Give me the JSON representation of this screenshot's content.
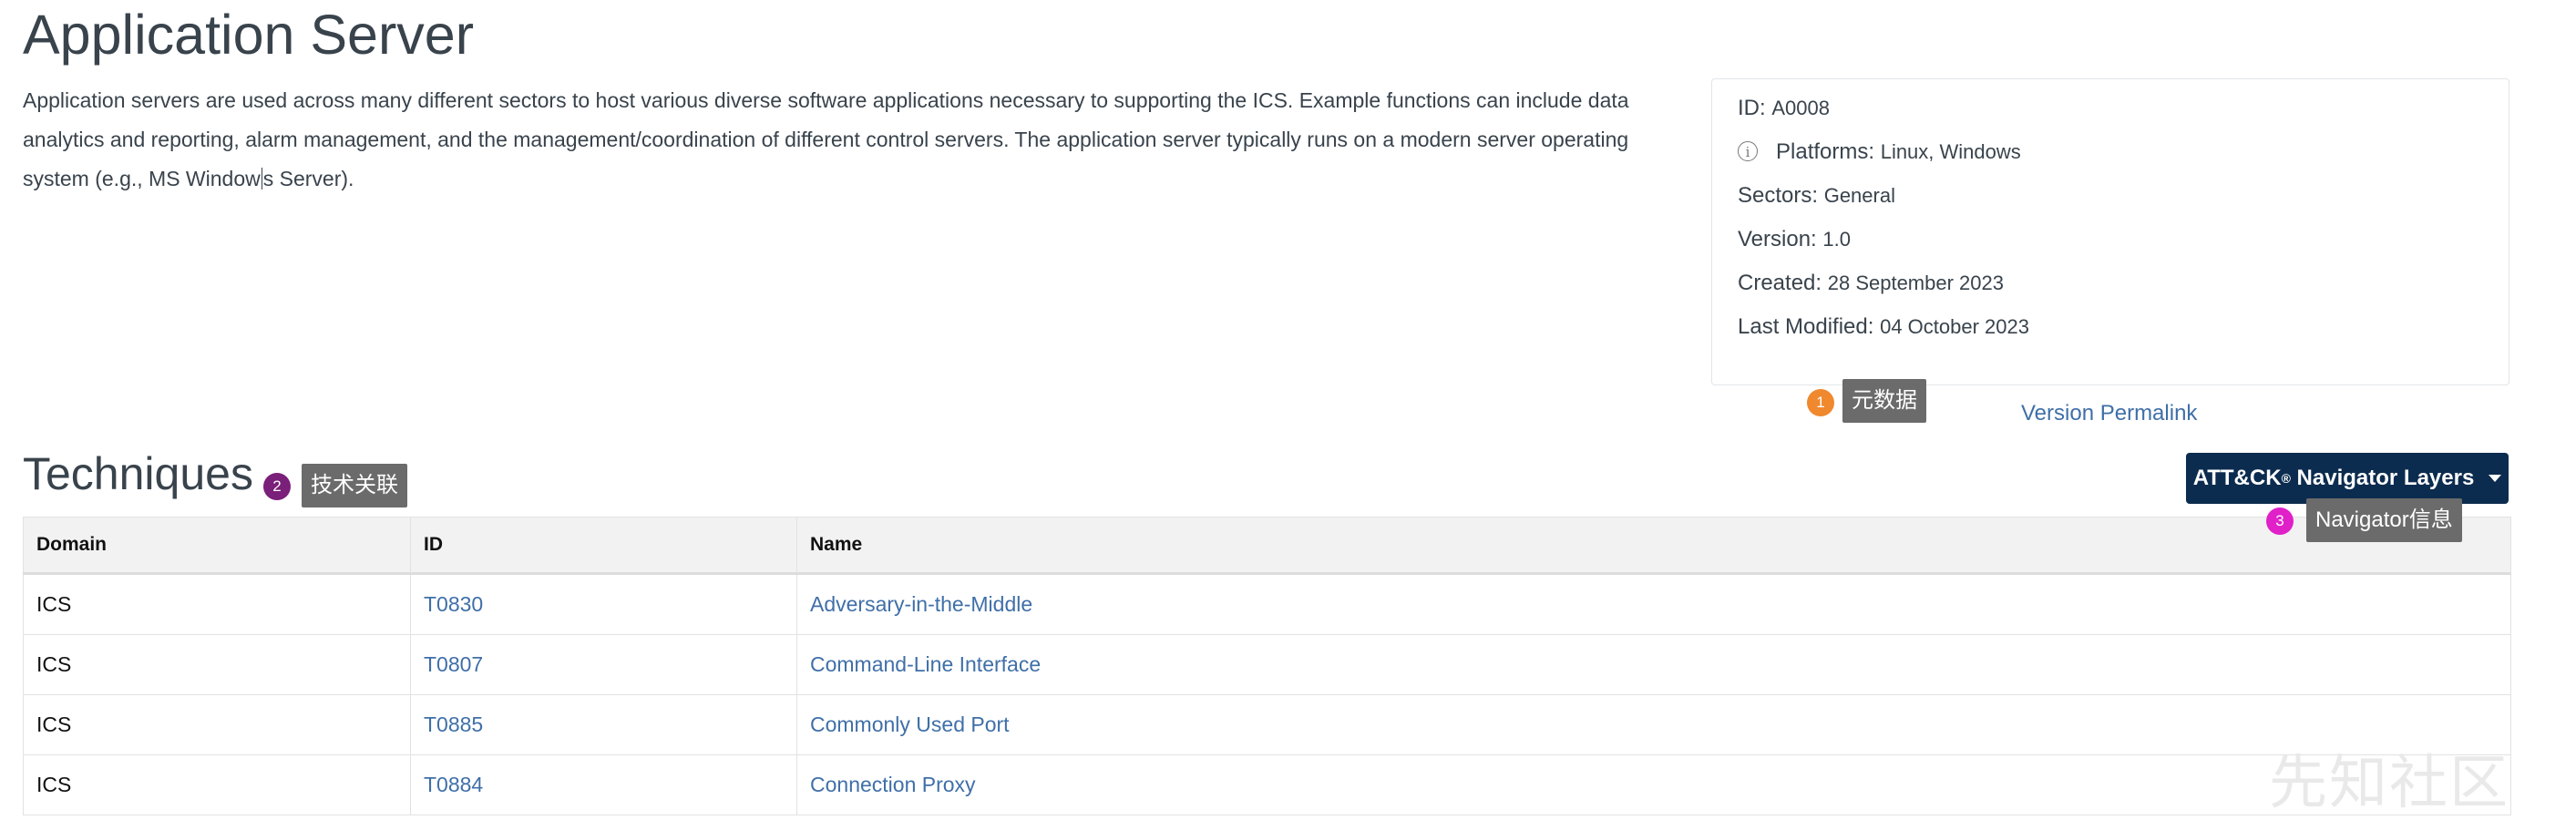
{
  "page": {
    "title": "Application Server",
    "description_part1": "Application servers are used across many different sectors to host various diverse software applications necessary to supporting the ICS. Example functions can include data analytics and reporting, alarm management, and the management/coordination of different control servers. The application server typically runs on a modern server operating system (e.g., MS Window",
    "description_part2": "s Server)."
  },
  "metadata": {
    "id_label": "ID:",
    "id_value": "A0008",
    "platforms_label": "Platforms:",
    "platforms_value": "Linux, Windows",
    "sectors_label": "Sectors:",
    "sectors_value": "General",
    "version_label": "Version:",
    "version_value": "1.0",
    "created_label": "Created:",
    "created_value": "28 September 2023",
    "modified_label": "Last Modified:",
    "modified_value": "04 October 2023",
    "info_icon": "info-circle-icon"
  },
  "permalink": "Version Permalink",
  "annotations": [
    {
      "num": "1",
      "text": "元数据",
      "color": "#f0882e"
    },
    {
      "num": "2",
      "text": "技术关联",
      "color": "#7a1f7a"
    },
    {
      "num": "3",
      "text": "Navigator信息",
      "color": "#e020c8"
    }
  ],
  "techniques": {
    "title": "Techniques",
    "navigator_button": {
      "prefix": "ATT&CK",
      "sup": "®",
      "suffix": " Navigator Layers",
      "icon": "caret-down-icon"
    },
    "columns": [
      "Domain",
      "ID",
      "Name"
    ],
    "rows": [
      {
        "domain": "ICS",
        "id": "T0830",
        "name": "Adversary-in-the-Middle"
      },
      {
        "domain": "ICS",
        "id": "T0807",
        "name": "Command-Line Interface"
      },
      {
        "domain": "ICS",
        "id": "T0885",
        "name": "Commonly Used Port"
      },
      {
        "domain": "ICS",
        "id": "T0884",
        "name": "Connection Proxy"
      }
    ]
  },
  "watermark": "先知社区"
}
